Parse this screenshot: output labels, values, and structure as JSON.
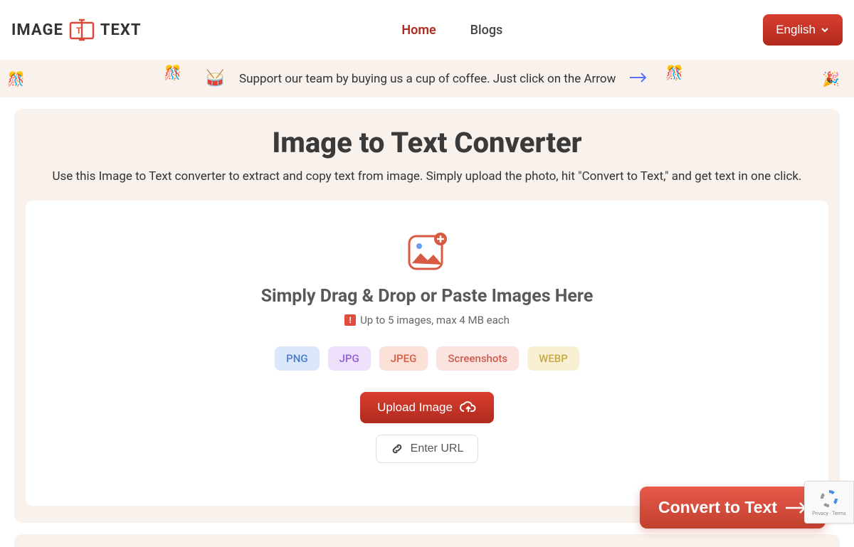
{
  "logo": {
    "text_left": "IMAGE",
    "text_right": "TEXT"
  },
  "nav": {
    "home": "Home",
    "blogs": "Blogs"
  },
  "language_button": "English",
  "banner": {
    "text": "Support our team by buying us a cup of coffee. Just click on the Arrow"
  },
  "hero": {
    "title": "Image to Text Converter",
    "subtitle": "Use this Image to Text converter to extract and copy text from image. Simply upload the photo, hit \"Convert to Text,\" and get text in one click."
  },
  "dropzone": {
    "title": "Simply Drag & Drop or Paste Images Here",
    "limit": "Up to 5 images, max 4 MB each",
    "formats": {
      "png": "PNG",
      "jpg": "JPG",
      "jpeg": "JPEG",
      "screenshots": "Screenshots",
      "webp": "WEBP"
    },
    "upload_button": "Upload Image",
    "url_button": "Enter URL"
  },
  "convert_button": "Convert to Text",
  "recaptcha": {
    "line1": "Privacy",
    "line2": "Terms"
  }
}
